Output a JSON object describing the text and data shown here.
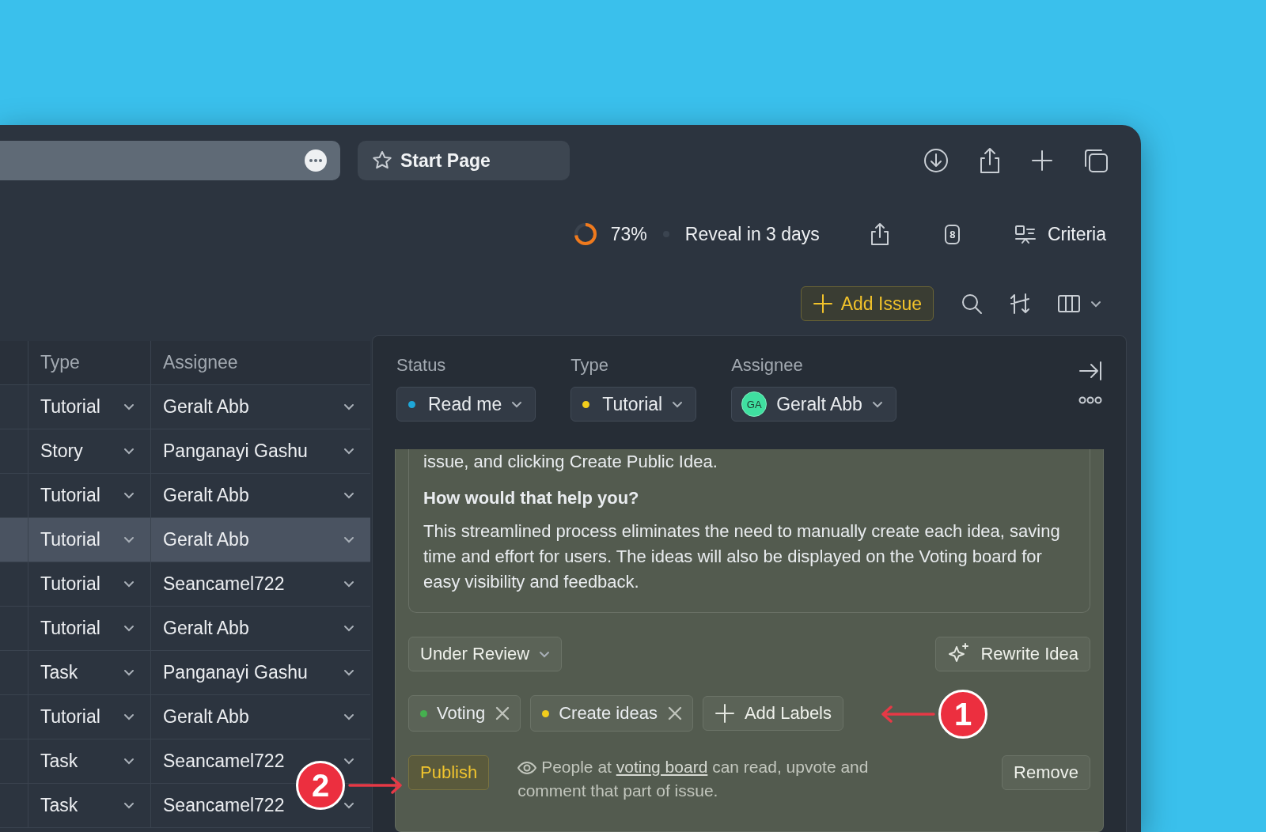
{
  "browser": {
    "tab_title": "Start Page"
  },
  "header": {
    "progress": {
      "level": 0.73,
      "reading": "73%"
    },
    "reveal": "Reveal in 3 days",
    "cards_count": "8",
    "criteria": "Criteria"
  },
  "toolbar": {
    "add_issue": "Add Issue"
  },
  "table": {
    "columns": [
      "Type",
      "Assignee"
    ],
    "rows": [
      {
        "type": "Tutorial",
        "assignee": "Geralt Abb",
        "selected": false
      },
      {
        "type": "Story",
        "assignee": "Panganayi Gashu",
        "selected": false
      },
      {
        "type": "Tutorial",
        "assignee": "Geralt Abb",
        "selected": false
      },
      {
        "type": "Tutorial",
        "assignee": "Geralt Abb",
        "selected": true
      },
      {
        "type": "Tutorial",
        "assignee": "Seancamel722",
        "selected": false
      },
      {
        "type": "Tutorial",
        "assignee": "Geralt Abb",
        "selected": false
      },
      {
        "type": "Task",
        "assignee": "Panganayi Gashu",
        "selected": false
      },
      {
        "type": "Tutorial",
        "assignee": "Geralt Abb",
        "selected": false
      },
      {
        "type": "Task",
        "assignee": "Seancamel722",
        "selected": false
      },
      {
        "type": "Task",
        "assignee": "Seancamel722",
        "selected": false
      }
    ]
  },
  "panel": {
    "fields": [
      {
        "label": "Status",
        "kind": "dot",
        "value": "Read me",
        "color": "#1ea7d8"
      },
      {
        "label": "Type",
        "kind": "dot",
        "value": "Tutorial",
        "color": "#f2cd1c"
      },
      {
        "label": "Assignee",
        "kind": "avatar",
        "value": "Geralt Abb",
        "initials": "GA"
      }
    ],
    "idea": {
      "description": [
        {
          "kind": "paragraph",
          "text": "issue, and clicking Create Public Idea."
        },
        {
          "kind": "heading",
          "text": "How would that help you?"
        },
        {
          "kind": "paragraph",
          "text": "This streamlined process eliminates the need to manually create each idea, saving time and effort for users. The ideas will also be displayed on the Voting board for easy visibility and feedback."
        }
      ],
      "state": "Under Review",
      "rewrite": "Rewrite Idea",
      "labels": [
        {
          "text": "Voting",
          "color": "#45b04f"
        },
        {
          "text": "Create ideas",
          "color": "#f2cd1c"
        }
      ],
      "add_labels": "Add Labels",
      "publish": "Publish",
      "notice": {
        "before": "People at",
        "link": "voting board",
        "after": "can read, upvote and comment that part of issue."
      },
      "remove": "Remove"
    }
  },
  "annotations": [
    {
      "number": "1"
    },
    {
      "number": "2"
    }
  ]
}
